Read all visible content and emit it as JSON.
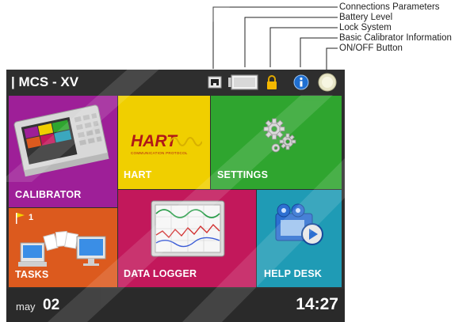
{
  "callouts": [
    {
      "label": "Connections Parameters"
    },
    {
      "label": "Battery Level"
    },
    {
      "label": "Lock System"
    },
    {
      "label": "Basic Calibrator Information"
    },
    {
      "label": "ON/OFF Button"
    }
  ],
  "header": {
    "title": "| MCS - XV",
    "icons": [
      "connection-icon",
      "battery-icon",
      "lock-icon",
      "info-icon",
      "power-icon"
    ]
  },
  "tiles": {
    "calibrator": {
      "label": "CALIBRATOR",
      "color": "#9e1f98"
    },
    "hart": {
      "label": "HART",
      "logo_text": "HART",
      "logo_sub": "COMMUNICATION PROTOCOL",
      "color": "#f0cf00"
    },
    "settings": {
      "label": "SETTINGS",
      "color": "#2fa52f"
    },
    "tasks": {
      "label": "TASKS",
      "flag_count": "1",
      "color": "#dc5a1e"
    },
    "datalogger": {
      "label": "DATA LOGGER",
      "color": "#c2185b"
    },
    "helpdesk": {
      "label": "HELP DESK",
      "color": "#1f9bb5"
    }
  },
  "status": {
    "month": "may",
    "day": "02",
    "time": "14:27"
  }
}
